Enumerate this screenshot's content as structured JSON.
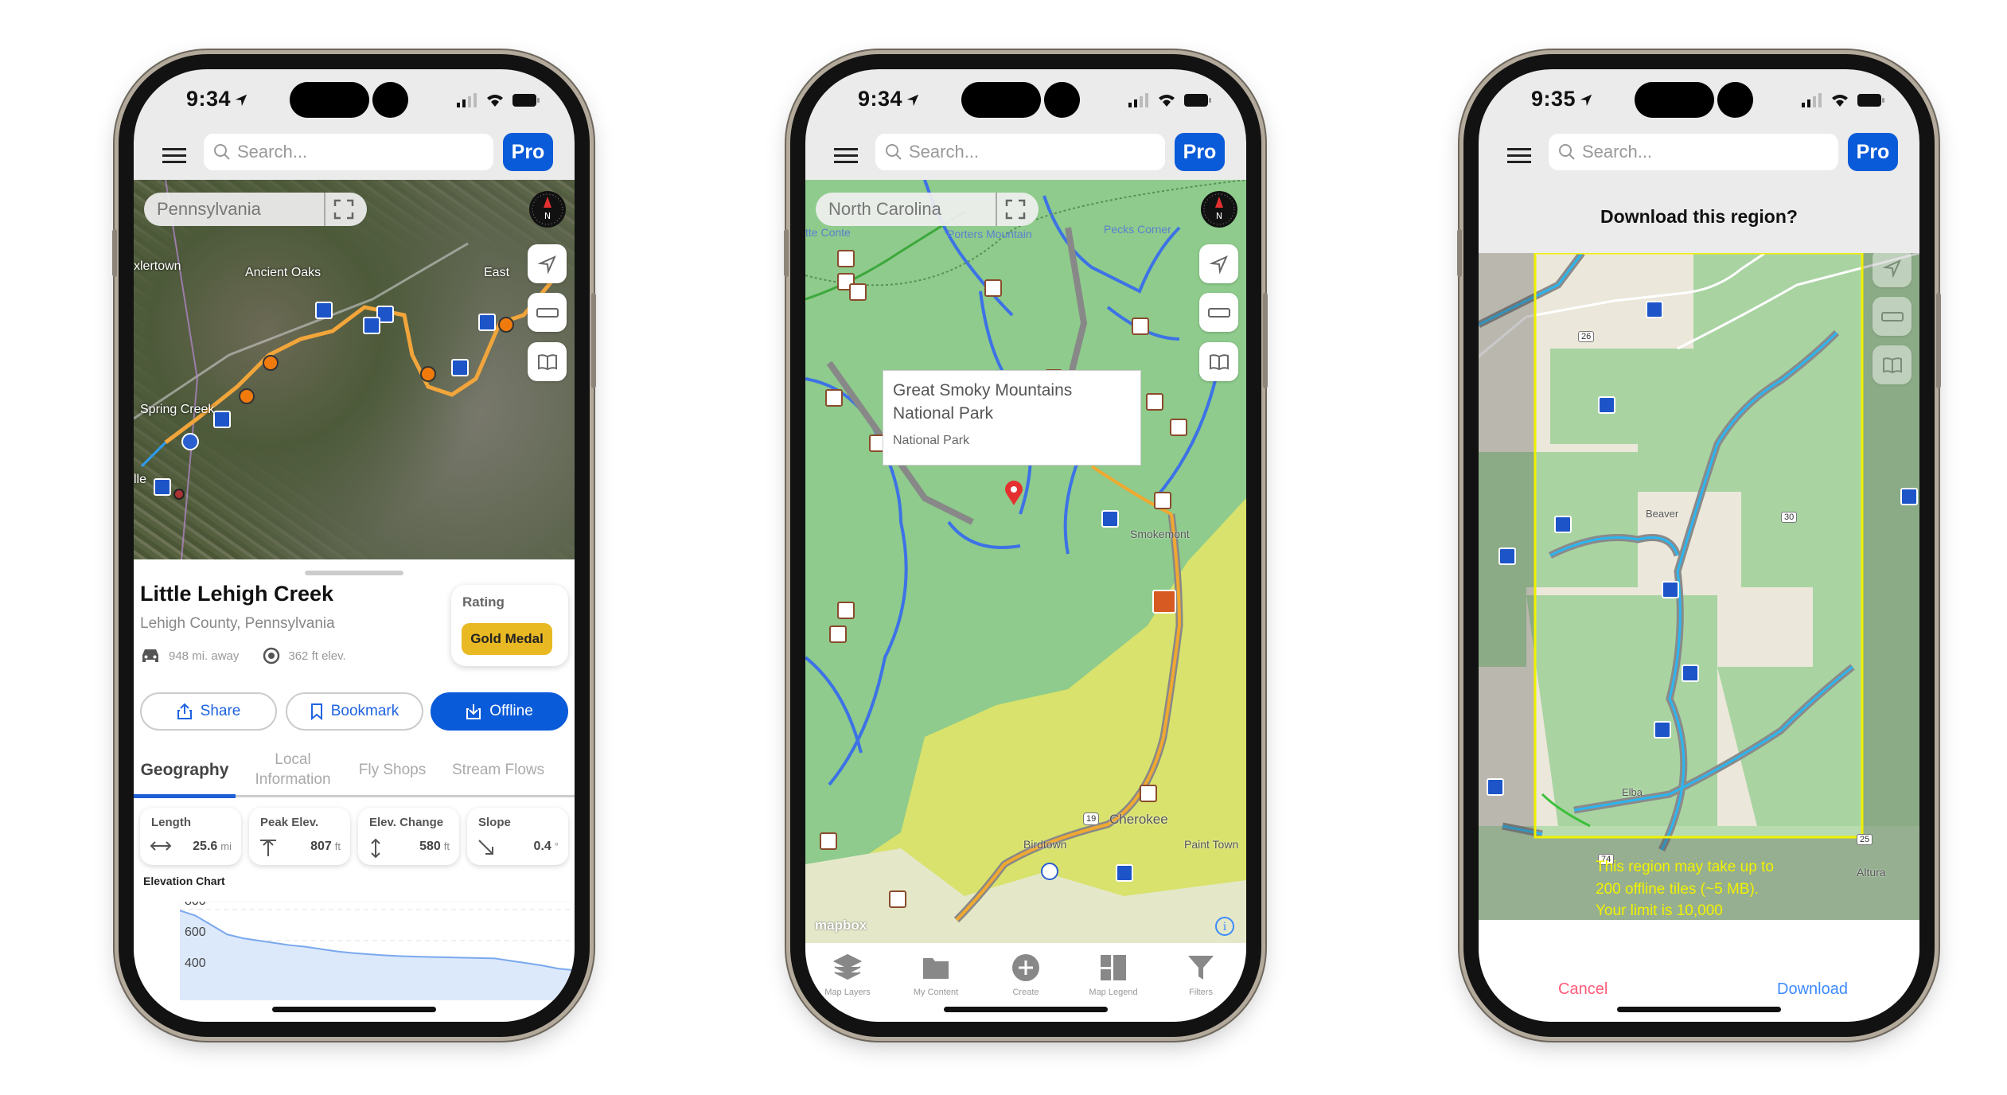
{
  "colors": {
    "accent": "#0a5bd9",
    "gold": "#e9b923",
    "cancel": "#ff5c7a",
    "download": "#3d8bff",
    "region_outline": "#f0f000"
  },
  "phones": [
    {
      "status": {
        "time": "9:34"
      },
      "header": {
        "search_placeholder": "Search...",
        "pro_label": "Pro"
      },
      "map": {
        "region": "Pennsylvania",
        "labels": [
          "Ancient Oaks",
          "Spring Creek",
          "xlertown",
          "East",
          "lle"
        ]
      },
      "detail": {
        "title": "Little Lehigh Creek",
        "subtitle": "Lehigh County, Pennsylvania",
        "distance": "948 mi. away",
        "elevation": "362 ft elev.",
        "rating_label": "Rating",
        "rating_value": "Gold Medal",
        "actions": {
          "share": "Share",
          "bookmark": "Bookmark",
          "offline": "Offline"
        },
        "tabs": [
          "Geography",
          "Local Information",
          "Fly Shops",
          "Stream Flows"
        ],
        "active_tab": "Geography",
        "stats": [
          {
            "label": "Length",
            "value": "25.6",
            "unit": "mi",
            "icon": "horizontal-arrows-icon"
          },
          {
            "label": "Peak Elev.",
            "value": "807",
            "unit": "ft",
            "icon": "peak-icon"
          },
          {
            "label": "Elev. Change",
            "value": "580",
            "unit": "ft",
            "icon": "vertical-arrows-icon"
          },
          {
            "label": "Slope",
            "value": "0.4",
            "unit": "°",
            "icon": "slope-arrow-icon"
          }
        ],
        "elevation_chart": {
          "title": "Elevation Chart",
          "y_ticks": [
            "800",
            "600",
            "400"
          ],
          "ylim": [
            216,
            830
          ],
          "values": [
            793,
            760,
            700,
            640,
            615,
            600,
            585,
            570,
            560,
            545,
            530,
            520,
            512,
            505,
            500,
            497,
            494,
            492,
            490,
            488,
            485,
            470,
            455,
            440,
            420,
            410
          ]
        }
      }
    },
    {
      "status": {
        "time": "9:34"
      },
      "header": {
        "search_placeholder": "Search...",
        "pro_label": "Pro"
      },
      "map": {
        "region": "North Carolina",
        "labels": [
          "Porters Mountain",
          "Pecks Corner",
          "Smokemont",
          "Cherokee",
          "Birdtown",
          "Paint Town",
          "tte Conte",
          "19"
        ],
        "popup": {
          "name": "Great Smoky Mountains National Park",
          "type": "National Park"
        },
        "attribution": "mapbox"
      },
      "tabbar": [
        {
          "label": "Map Layers",
          "icon": "layers-icon"
        },
        {
          "label": "My Content",
          "icon": "folder-icon"
        },
        {
          "label": "Create",
          "icon": "plus-circle-icon"
        },
        {
          "label": "Map Legend",
          "icon": "legend-icon"
        },
        {
          "label": "Filters",
          "icon": "funnel-icon"
        }
      ]
    },
    {
      "status": {
        "time": "9:35"
      },
      "header": {
        "search_placeholder": "Search...",
        "pro_label": "Pro"
      },
      "dialog": {
        "title": "Download this region?",
        "message": "This region may take up to 200 offline tiles (~5 MB). Your limit is 10,000",
        "cancel": "Cancel",
        "confirm": "Download"
      },
      "map": {
        "labels": [
          "Beaver",
          "Elba",
          "Altura"
        ],
        "route_shields": [
          "26",
          "30",
          "74",
          "25"
        ]
      }
    }
  ]
}
